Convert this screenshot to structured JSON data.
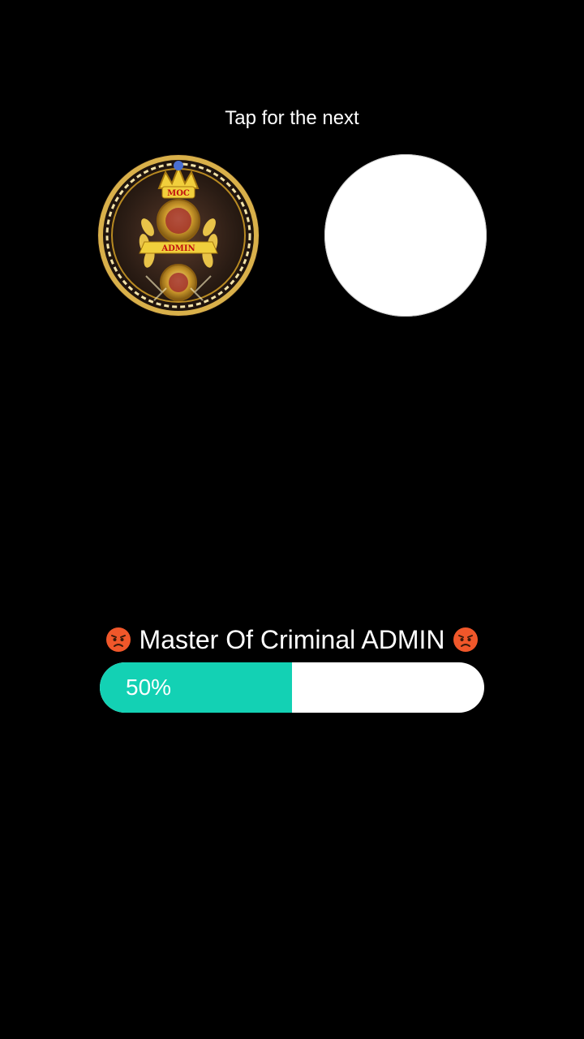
{
  "hint_text": "Tap for the next",
  "choices": {
    "left_avatar": {
      "icon": "admin-crest-emblem",
      "emblem_text_top": "MOC",
      "emblem_text_banner": "ADMIN"
    },
    "right_avatar": {
      "icon": "blank-white-circle"
    }
  },
  "title": {
    "prefix_icon": "angry-face-emoji",
    "text": "Master Of Criminal ADMIN",
    "suffix_icon": "angry-face-emoji"
  },
  "progress": {
    "value": 0.5,
    "label": "50%",
    "fill_color": "#13d1b4",
    "track_color": "#ffffff"
  }
}
